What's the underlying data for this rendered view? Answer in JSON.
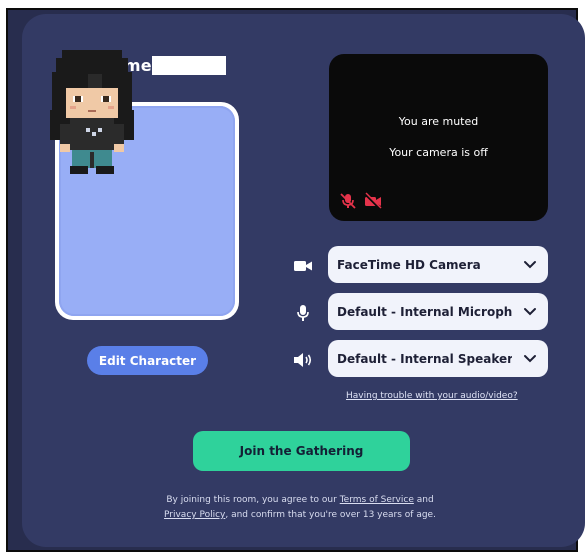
{
  "welcome": {
    "greeting": "Welcome,"
  },
  "avatar": {
    "edit_label": "Edit Character"
  },
  "preview": {
    "muted_text": "You are muted",
    "camera_off_text": "Your camera is off"
  },
  "devices": {
    "camera": "FaceTime HD Camera",
    "microphone": "Default - Internal Micropho...",
    "speaker": "Default - Internal Speakers ..."
  },
  "help_link": "Having trouble with your audio/video?",
  "join_label": "Join the Gathering",
  "legal": {
    "part1": "By joining this room, you agree to our ",
    "terms": "Terms of Service",
    "part2": " and",
    "privacy": "Privacy Policy",
    "part3": ", and confirm that you're over 13 years of age."
  },
  "colors": {
    "background": "#333a64",
    "accent_join": "#2fd29b",
    "accent_edit": "#5a7fe8",
    "muted_icon": "#e5334b"
  },
  "icons": [
    "mic-off-icon",
    "camera-off-icon",
    "video-camera-icon",
    "microphone-icon",
    "speaker-icon",
    "chevron-down-icon"
  ]
}
